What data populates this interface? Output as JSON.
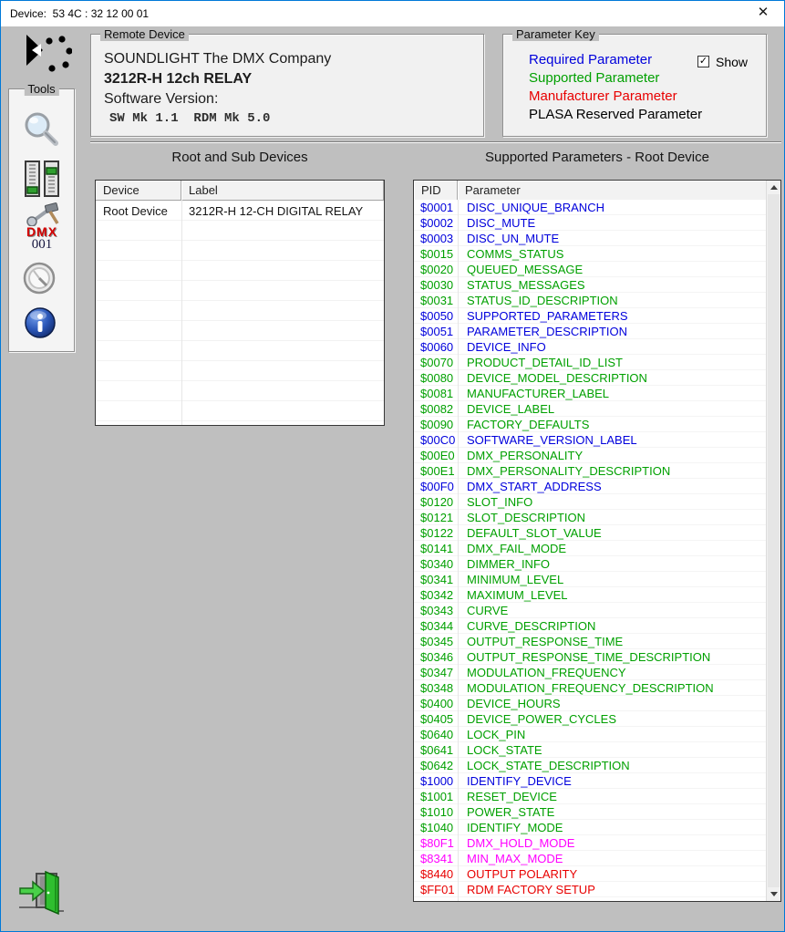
{
  "window": {
    "title": "Device:  53 4C : 32 12 00 01",
    "close_glyph": "✕"
  },
  "remote_device": {
    "label": "Remote Device",
    "manufacturer": "SOUNDLIGHT The DMX Company",
    "model": "3212R-H 12ch RELAY",
    "software_version_label": "Software Version:",
    "software_version_value": "SW Mk 1.1  RDM Mk 5.0"
  },
  "parameter_key": {
    "label": "Parameter Key",
    "items": [
      {
        "text": "Required Parameter",
        "color": "#0000dc"
      },
      {
        "text": "Supported Parameter",
        "color": "#00a000"
      },
      {
        "text": "Manufacturer Parameter",
        "color": "#e80000"
      },
      {
        "text": "PLASA Reserved Parameter",
        "color": "#000000"
      }
    ],
    "show_label": "Show",
    "show_checked": true,
    "check_glyph": "✓"
  },
  "tools": {
    "label": "Tools",
    "dmx_text": "DMX",
    "dmx_number": "001",
    "icons": [
      "magnifier-icon",
      "faders-icon",
      "dmx-setup-icon",
      "gauge-icon",
      "info-icon"
    ]
  },
  "exit": {
    "icon": "exit-door-icon"
  },
  "devices_section": {
    "title": "Root and Sub Devices",
    "columns": [
      "Device",
      "Label"
    ],
    "rows": [
      [
        "Root Device",
        "3212R-H 12-CH DIGITAL RELAY"
      ]
    ],
    "empty_row_count": 10
  },
  "parameters_section": {
    "title": "Supported Parameters - Root Device",
    "columns": [
      "PID",
      "Parameter"
    ],
    "category_colors": {
      "required": "#0000dc",
      "supported": "#00a000",
      "manufacturer_red": "#e80000",
      "manufacturer_magenta": "#ff00ff"
    },
    "rows": [
      {
        "pid": "$0001",
        "name": "DISC_UNIQUE_BRANCH",
        "category": "required"
      },
      {
        "pid": "$0002",
        "name": "DISC_MUTE",
        "category": "required"
      },
      {
        "pid": "$0003",
        "name": "DISC_UN_MUTE",
        "category": "required"
      },
      {
        "pid": "$0015",
        "name": "COMMS_STATUS",
        "category": "supported"
      },
      {
        "pid": "$0020",
        "name": "QUEUED_MESSAGE",
        "category": "supported"
      },
      {
        "pid": "$0030",
        "name": "STATUS_MESSAGES",
        "category": "supported"
      },
      {
        "pid": "$0031",
        "name": "STATUS_ID_DESCRIPTION",
        "category": "supported"
      },
      {
        "pid": "$0050",
        "name": "SUPPORTED_PARAMETERS",
        "category": "required"
      },
      {
        "pid": "$0051",
        "name": "PARAMETER_DESCRIPTION",
        "category": "required"
      },
      {
        "pid": "$0060",
        "name": "DEVICE_INFO",
        "category": "required"
      },
      {
        "pid": "$0070",
        "name": "PRODUCT_DETAIL_ID_LIST",
        "category": "supported"
      },
      {
        "pid": "$0080",
        "name": "DEVICE_MODEL_DESCRIPTION",
        "category": "supported"
      },
      {
        "pid": "$0081",
        "name": "MANUFACTURER_LABEL",
        "category": "supported"
      },
      {
        "pid": "$0082",
        "name": "DEVICE_LABEL",
        "category": "supported"
      },
      {
        "pid": "$0090",
        "name": "FACTORY_DEFAULTS",
        "category": "supported"
      },
      {
        "pid": "$00C0",
        "name": "SOFTWARE_VERSION_LABEL",
        "category": "required"
      },
      {
        "pid": "$00E0",
        "name": "DMX_PERSONALITY",
        "category": "supported"
      },
      {
        "pid": "$00E1",
        "name": "DMX_PERSONALITY_DESCRIPTION",
        "category": "supported"
      },
      {
        "pid": "$00F0",
        "name": "DMX_START_ADDRESS",
        "category": "required"
      },
      {
        "pid": "$0120",
        "name": "SLOT_INFO",
        "category": "supported"
      },
      {
        "pid": "$0121",
        "name": "SLOT_DESCRIPTION",
        "category": "supported"
      },
      {
        "pid": "$0122",
        "name": "DEFAULT_SLOT_VALUE",
        "category": "supported"
      },
      {
        "pid": "$0141",
        "name": "DMX_FAIL_MODE",
        "category": "supported"
      },
      {
        "pid": "$0340",
        "name": "DIMMER_INFO",
        "category": "supported"
      },
      {
        "pid": "$0341",
        "name": "MINIMUM_LEVEL",
        "category": "supported"
      },
      {
        "pid": "$0342",
        "name": "MAXIMUM_LEVEL",
        "category": "supported"
      },
      {
        "pid": "$0343",
        "name": "CURVE",
        "category": "supported"
      },
      {
        "pid": "$0344",
        "name": "CURVE_DESCRIPTION",
        "category": "supported"
      },
      {
        "pid": "$0345",
        "name": "OUTPUT_RESPONSE_TIME",
        "category": "supported"
      },
      {
        "pid": "$0346",
        "name": "OUTPUT_RESPONSE_TIME_DESCRIPTION",
        "category": "supported"
      },
      {
        "pid": "$0347",
        "name": "MODULATION_FREQUENCY",
        "category": "supported"
      },
      {
        "pid": "$0348",
        "name": "MODULATION_FREQUENCY_DESCRIPTION",
        "category": "supported"
      },
      {
        "pid": "$0400",
        "name": "DEVICE_HOURS",
        "category": "supported"
      },
      {
        "pid": "$0405",
        "name": "DEVICE_POWER_CYCLES",
        "category": "supported"
      },
      {
        "pid": "$0640",
        "name": "LOCK_PIN",
        "category": "supported"
      },
      {
        "pid": "$0641",
        "name": "LOCK_STATE",
        "category": "supported"
      },
      {
        "pid": "$0642",
        "name": "LOCK_STATE_DESCRIPTION",
        "category": "supported"
      },
      {
        "pid": "$1000",
        "name": "IDENTIFY_DEVICE",
        "category": "required"
      },
      {
        "pid": "$1001",
        "name": "RESET_DEVICE",
        "category": "supported"
      },
      {
        "pid": "$1010",
        "name": "POWER_STATE",
        "category": "supported"
      },
      {
        "pid": "$1040",
        "name": "IDENTIFY_MODE",
        "category": "supported"
      },
      {
        "pid": "$80F1",
        "name": "DMX_HOLD_MODE",
        "category": "manufacturer_magenta"
      },
      {
        "pid": "$8341",
        "name": "MIN_MAX_MODE",
        "category": "manufacturer_magenta"
      },
      {
        "pid": "$8440",
        "name": "OUTPUT POLARITY",
        "category": "manufacturer_red"
      },
      {
        "pid": "$FF01",
        "name": "RDM FACTORY SETUP",
        "category": "manufacturer_red"
      }
    ]
  }
}
